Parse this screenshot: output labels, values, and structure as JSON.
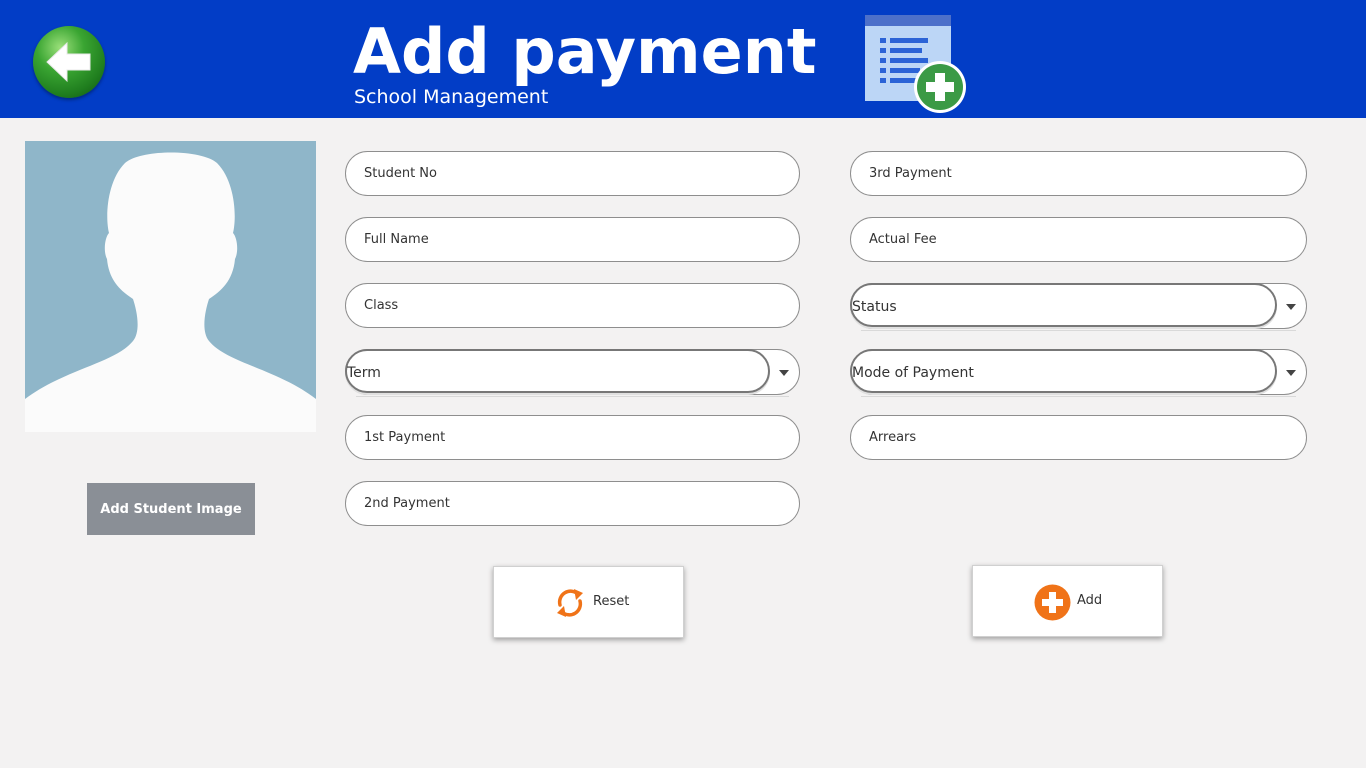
{
  "header": {
    "title": "Add payment",
    "subtitle": "School Management",
    "back_icon": "arrow-left-icon",
    "document_icon": "document-add-icon",
    "background_color": "#023dc6"
  },
  "photo": {
    "icon": "person-silhouette-icon",
    "add_image_label": "Add Student Image"
  },
  "form": {
    "left_fields": [
      {
        "placeholder": "Student No",
        "value": ""
      },
      {
        "placeholder": "Full Name",
        "value": ""
      },
      {
        "placeholder": "Class",
        "value": ""
      },
      {
        "dropdown": true,
        "selected": "Term"
      },
      {
        "placeholder": "1st Payment",
        "value": ""
      },
      {
        "placeholder": "2nd Payment",
        "value": ""
      }
    ],
    "right_fields": [
      {
        "placeholder": "3rd Payment",
        "value": ""
      },
      {
        "placeholder": "Actual Fee",
        "value": ""
      },
      {
        "dropdown": true,
        "selected": "Status"
      },
      {
        "dropdown": true,
        "selected": "Mode of Payment"
      },
      {
        "placeholder": "Arrears",
        "value": ""
      }
    ]
  },
  "actions": {
    "reset_label": "Reset",
    "reset_icon": "refresh-icon",
    "add_label": "Add",
    "add_icon": "plus-circle-icon",
    "accent_color": "#f07318"
  }
}
